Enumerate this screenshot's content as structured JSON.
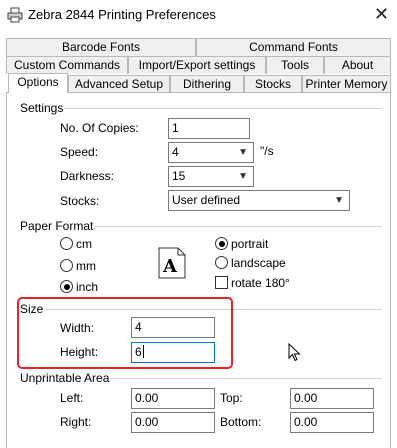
{
  "window": {
    "title": "Zebra 2844 Printing Preferences",
    "printer_icon": "printer-icon",
    "close_icon": "close-icon"
  },
  "tabs": {
    "row1": [
      "Barcode Fonts",
      "Command Fonts"
    ],
    "row2": [
      "Custom Commands",
      "Import/Export settings",
      "Tools",
      "About"
    ],
    "row3": [
      "Options",
      "Advanced Setup",
      "Dithering",
      "Stocks",
      "Printer Memory"
    ],
    "active": "Options"
  },
  "settings": {
    "group_label": "Settings",
    "copies_label": "No. Of Copies:",
    "copies_value": "1",
    "speed_label": "Speed:",
    "speed_value": "4",
    "speed_unit": "\"/s",
    "darkness_label": "Darkness:",
    "darkness_value": "15",
    "stocks_label": "Stocks:",
    "stocks_value": "User defined"
  },
  "paper_format": {
    "group_label": "Paper Format",
    "units": [
      "cm",
      "mm",
      "inch"
    ],
    "selected_unit": "inch",
    "preview_letter": "A",
    "orientations": [
      "portrait",
      "landscape"
    ],
    "selected_orientation": "portrait",
    "rotate_label": "rotate 180°",
    "rotate_checked": false
  },
  "size": {
    "group_label": "Size",
    "width_label": "Width:",
    "width_value": "4",
    "height_label": "Height:",
    "height_value": "6"
  },
  "unprintable": {
    "group_label": "Unprintable Area",
    "left_label": "Left:",
    "left_value": "0.00",
    "top_label": "Top:",
    "top_value": "0.00",
    "right_label": "Right:",
    "right_value": "0.00",
    "bottom_label": "Bottom:",
    "bottom_value": "0.00"
  },
  "colors": {
    "highlight": "#e8252a",
    "focus": "#0078d7"
  }
}
